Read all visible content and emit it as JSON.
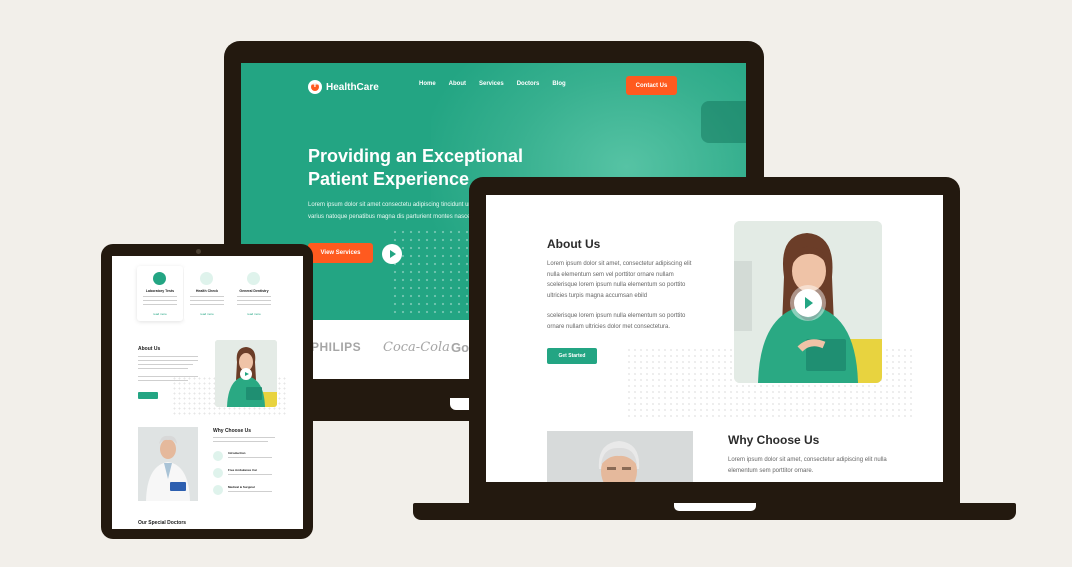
{
  "desktop": {
    "brand": "HealthCare",
    "nav": [
      "Home",
      "About",
      "Services",
      "Doctors",
      "Blog"
    ],
    "contact_button": "Contact Us",
    "hero_title_line1": "Providing an Exceptional",
    "hero_title_line2": "Patient Experience",
    "hero_paragraph": "Lorem ipsum dolor sit amet consectetu adipiscing tincidunt urna. Orci varius natoque penatibus magna dis parturient montes nascetur.",
    "services_button": "View Services",
    "partner_logos": [
      "PHILIPS",
      "Coca-Cola",
      "Go"
    ]
  },
  "laptop": {
    "about_title": "About Us",
    "about_paragraph_1": "Lorem ipsum dolor sit amet, consectetur adipiscing elit nulla elementum sem vel porttitor ornare nullam scelerisque lorem ipsum nulla elementum so porttito ultricies turpis magna accumsan ebild",
    "about_paragraph_2": "scelerisque lorem ipsum nulla elementum so porttito ornare nullam ultricies dolor met consectetura.",
    "get_started_button": "Get Started",
    "why_title": "Why Choose Us",
    "why_paragraph": "Lorem ipsum dolor sit amet, consectetur adipiscing elit nulla elementum sem porttitor ornare."
  },
  "tablet": {
    "cards": [
      {
        "label": "Laboratory Tests",
        "link": "read more"
      },
      {
        "label": "Health Check",
        "link": "read more"
      },
      {
        "label": "General Dentistry",
        "link": "read more"
      }
    ],
    "about_title": "About Us",
    "about_button": "Get Started",
    "why_title": "Why Choose Us",
    "why_items": [
      "Introduction",
      "Free Ambulance Car",
      "Medical & Surgical"
    ],
    "doctors_title": "Our Special Doctors"
  },
  "colors": {
    "primary": "#23a583",
    "accent": "#ff5a1f",
    "frame": "#23190f",
    "background": "#f2efea"
  }
}
